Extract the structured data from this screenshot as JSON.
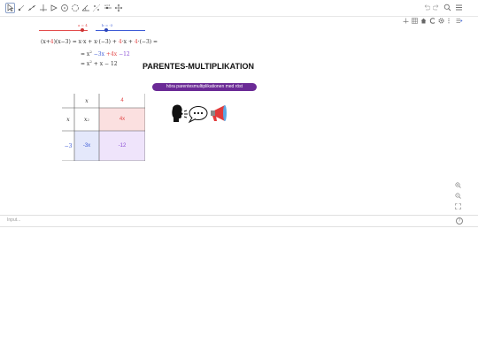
{
  "toolbar": {
    "tools": [
      "move-tool",
      "point-tool",
      "line-tool",
      "perpendicular-tool",
      "polygon-tool",
      "circle-tool",
      "ellipse-tool",
      "angle-tool",
      "reflect-tool",
      "slider-tool",
      "move-graphics-tool"
    ],
    "right_icons": [
      "undo-icon",
      "redo-icon",
      "search-icon",
      "menu-icon"
    ]
  },
  "graphics_menu": [
    "axes-icon",
    "grid-icon",
    "home-icon",
    "pointcapture-icon",
    "settings-icon",
    "more-icon",
    "style-bar-icon"
  ],
  "sliders": {
    "a": {
      "label": "a = 4",
      "value": 4,
      "color": "#e34c4c"
    },
    "b": {
      "label": "b = -3",
      "value": -3,
      "color": "#3d5bd6"
    }
  },
  "expression": {
    "line1_open": "(x+",
    "line1_a": "4",
    "line1_mid": ")(x−3) = x·x + x·(−3) + ",
    "line1_a2": "4",
    "line1_mid2": "·x + ",
    "line1_a3": "4",
    "line1_end": "·(−3) =",
    "line2_prefix": "= x",
    "line2_sup": "2",
    "line2_b": " −3x",
    "line2_a": " +4x",
    "line2_end": " −12",
    "line3_prefix": "= x",
    "line3_sup": "2",
    "line3_end": " + x − 12"
  },
  "heading": "PARENTES-MULTIPLIKATION",
  "audio_button": "höra parentesmultiplikationen med röst",
  "grid": {
    "header_x": "x",
    "header_a": "4",
    "row1_label": "x",
    "row1_xx": "x",
    "row1_xx_sup": "2",
    "row1_xa": "4x",
    "row2_label": "−3",
    "row2_bx": "-3x",
    "row2_ab": "-12"
  },
  "colors": {
    "red": "#e34c4c",
    "blue": "#3d5bd6",
    "pink_cell": "#fbe0e0",
    "blue_cell": "#e4e8fb",
    "purple_cell": "#efe4fb",
    "button_purple": "#6b2a96"
  },
  "zoom_icons": [
    "zoom-in-icon",
    "zoom-out-icon",
    "fullscreen-icon"
  ],
  "input": {
    "placeholder": "Input..."
  }
}
